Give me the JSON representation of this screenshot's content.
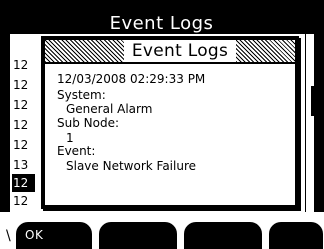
{
  "background_window": {
    "title": "Event Logs",
    "rows": [
      {
        "text": "12",
        "selected": false
      },
      {
        "text": "12",
        "selected": false
      },
      {
        "text": "12",
        "selected": false
      },
      {
        "text": "12",
        "selected": false
      },
      {
        "text": "12",
        "selected": false
      },
      {
        "text": "13",
        "selected": false
      },
      {
        "text": "12",
        "selected": true
      },
      {
        "text": "12",
        "selected": false
      }
    ]
  },
  "dialog": {
    "title": "Event Logs",
    "timestamp": "12/03/2008  02:29:33 PM",
    "system_label": "System:",
    "system_value": "General Alarm",
    "subnode_label": "Sub Node:",
    "subnode_value": "1",
    "event_label": "Event:",
    "event_value": "Slave Network Failure"
  },
  "softkeys": {
    "key1_label": "OK",
    "key2_label": "",
    "key3_label": "",
    "key4_label": ""
  },
  "colors": {
    "background": "#ffffff",
    "foreground": "#000000"
  }
}
